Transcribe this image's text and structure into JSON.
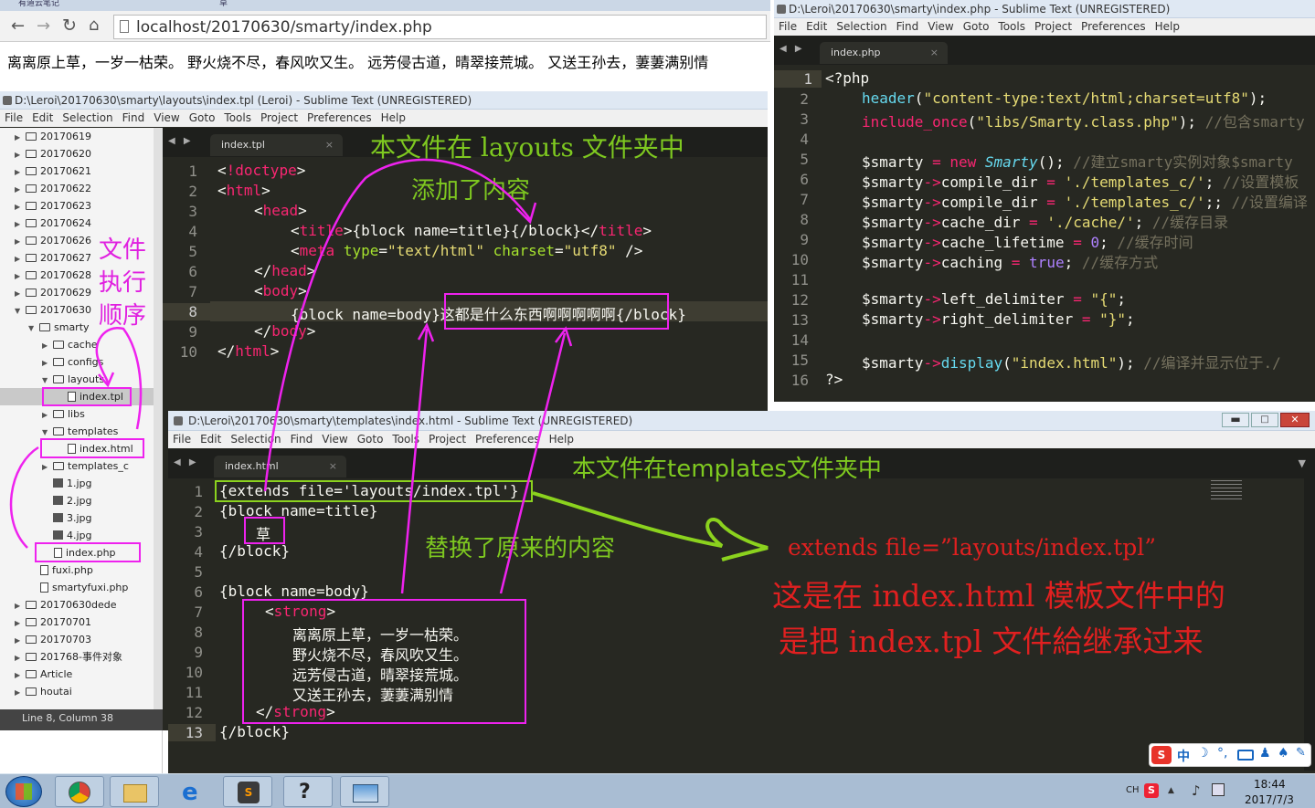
{
  "browser": {
    "tab1": "有道云笔记",
    "tab2": "草",
    "url": "localhost/20170630/smarty/index.php",
    "page_text": "离离原上草，一岁一枯荣。 野火烧不尽，春风吹又生。 远芳侵古道，晴翠接荒城。 又送王孙去，萋萋满别情"
  },
  "menu": [
    "File",
    "Edit",
    "Selection",
    "Find",
    "View",
    "Goto",
    "Tools",
    "Project",
    "Preferences",
    "Help"
  ],
  "win_left": {
    "title": "D:\\Leroi\\20170630\\smarty\\layouts\\index.tpl (Leroi) - Sublime Text (UNREGISTERED)",
    "tab": "index.tpl",
    "status": "Line 8, Column 38"
  },
  "win_right": {
    "title": "D:\\Leroi\\20170630\\smarty\\index.php - Sublime Text (UNREGISTERED)",
    "tab": "index.php"
  },
  "win_bottom": {
    "title": "D:\\Leroi\\20170630\\smarty\\templates\\index.html - Sublime Text (UNREGISTERED)",
    "tab": "index.html"
  },
  "tree": [
    {
      "t": "20170619",
      "d": 0,
      "k": "folder",
      "a": "▶"
    },
    {
      "t": "20170620",
      "d": 0,
      "k": "folder",
      "a": "▶"
    },
    {
      "t": "20170621",
      "d": 0,
      "k": "folder",
      "a": "▶"
    },
    {
      "t": "20170622",
      "d": 0,
      "k": "folder",
      "a": "▶"
    },
    {
      "t": "20170623",
      "d": 0,
      "k": "folder",
      "a": "▶"
    },
    {
      "t": "20170624",
      "d": 0,
      "k": "folder",
      "a": "▶"
    },
    {
      "t": "20170626",
      "d": 0,
      "k": "folder",
      "a": "▶"
    },
    {
      "t": "20170627",
      "d": 0,
      "k": "folder",
      "a": "▶"
    },
    {
      "t": "20170628",
      "d": 0,
      "k": "folder",
      "a": "▶"
    },
    {
      "t": "20170629",
      "d": 0,
      "k": "folder",
      "a": "▶"
    },
    {
      "t": "20170630",
      "d": 0,
      "k": "folder",
      "a": "▼"
    },
    {
      "t": "smarty",
      "d": 1,
      "k": "folder",
      "a": "▼"
    },
    {
      "t": "cache",
      "d": 2,
      "k": "folder",
      "a": "▶"
    },
    {
      "t": "configs",
      "d": 2,
      "k": "folder",
      "a": "▶"
    },
    {
      "t": "layouts",
      "d": 2,
      "k": "folder",
      "a": "▼"
    },
    {
      "t": "index.tpl",
      "d": 3,
      "k": "file",
      "a": ""
    },
    {
      "t": "libs",
      "d": 2,
      "k": "folder",
      "a": "▶"
    },
    {
      "t": "templates",
      "d": 2,
      "k": "folder",
      "a": "▼"
    },
    {
      "t": "index.html",
      "d": 3,
      "k": "file",
      "a": ""
    },
    {
      "t": "templates_c",
      "d": 2,
      "k": "folder",
      "a": "▶"
    },
    {
      "t": "1.jpg",
      "d": 2,
      "k": "img",
      "a": ""
    },
    {
      "t": "2.jpg",
      "d": 2,
      "k": "img",
      "a": ""
    },
    {
      "t": "3.jpg",
      "d": 2,
      "k": "img",
      "a": ""
    },
    {
      "t": "4.jpg",
      "d": 2,
      "k": "img",
      "a": ""
    },
    {
      "t": "index.php",
      "d": 2,
      "k": "file",
      "a": ""
    },
    {
      "t": "fuxi.php",
      "d": 1,
      "k": "file",
      "a": ""
    },
    {
      "t": "smartyfuxi.php",
      "d": 1,
      "k": "file",
      "a": ""
    },
    {
      "t": "20170630dede",
      "d": 0,
      "k": "folder",
      "a": "▶"
    },
    {
      "t": "20170701",
      "d": 0,
      "k": "folder",
      "a": "▶"
    },
    {
      "t": "20170703",
      "d": 0,
      "k": "folder",
      "a": "▶"
    },
    {
      "t": "201768-事件对象",
      "d": 0,
      "k": "folder",
      "a": "▶"
    },
    {
      "t": "Article",
      "d": 0,
      "k": "folder",
      "a": "▶"
    },
    {
      "t": "houtai",
      "d": 0,
      "k": "folder",
      "a": "▶"
    }
  ],
  "ann": {
    "layouts": "本文件在 layouts 文件夹中",
    "added": "添加了内容",
    "order": [
      "文件",
      "执行",
      "顺序"
    ],
    "templates": "本文件在templates文件夹中",
    "replaced": "替换了原来的内容",
    "ext1": "extends file=”layouts/index.tpl”",
    "ext2": "这是在 index.html 模板文件中的",
    "ext3": "是把 index.tpl 文件給继承过来"
  },
  "clock": {
    "time": "18:44",
    "date": "2017/7/3",
    "ime": "CH"
  },
  "ime_bar": "中"
}
